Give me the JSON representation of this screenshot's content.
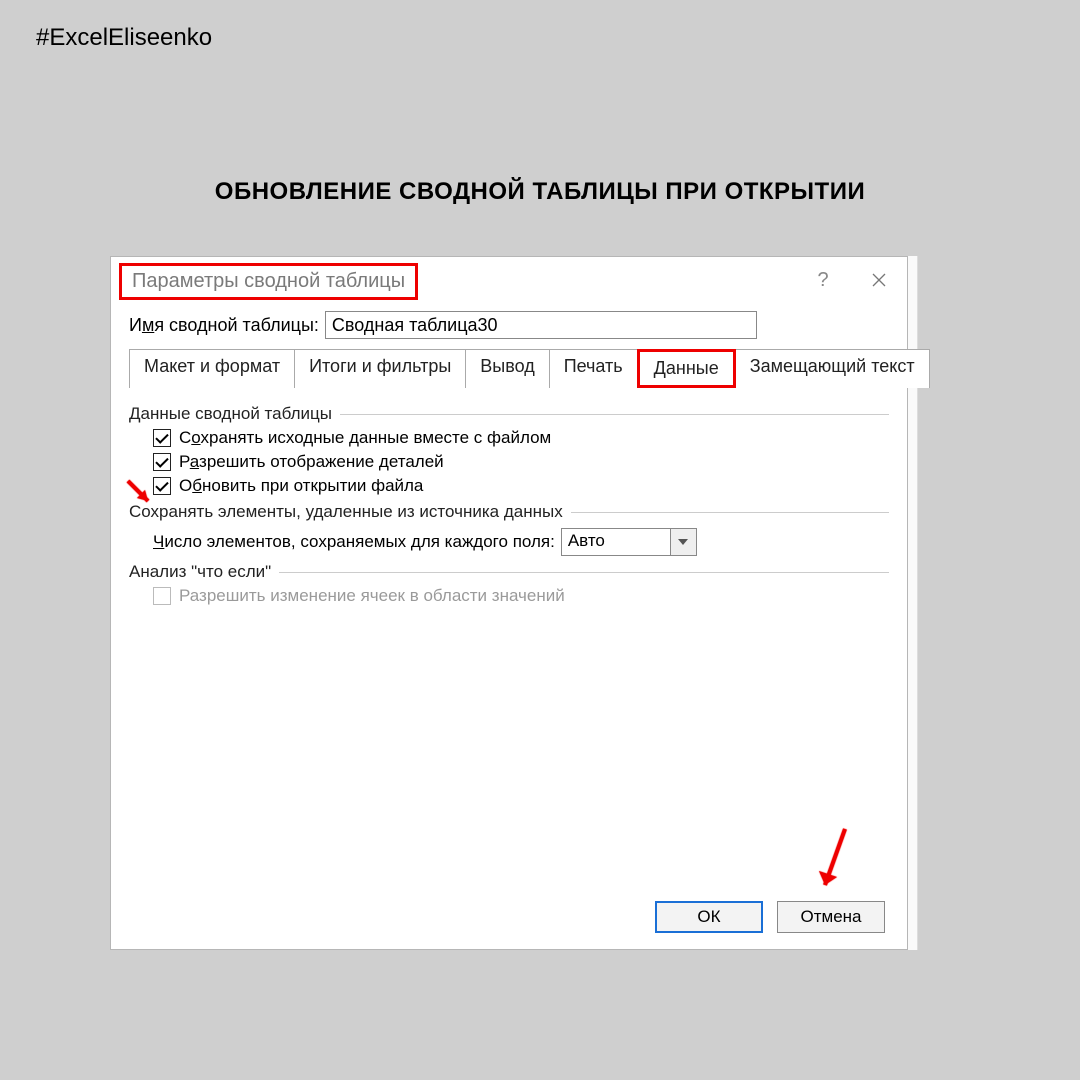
{
  "hashtag": "#ExcelEliseenko",
  "page_title": "ОБНОВЛЕНИЕ СВОДНОЙ ТАБЛИЦЫ ПРИ ОТКРЫТИИ",
  "dialog": {
    "title": "Параметры сводной таблицы",
    "help": "?",
    "name_label_pre": "И",
    "name_label_u": "м",
    "name_label_post": "я сводной таблицы:",
    "name_value": "Сводная таблица30",
    "tabs": {
      "t0": "Макет и формат",
      "t1": "Итоги и фильтры",
      "t2": "Вывод",
      "t3": "Печать",
      "t4": "Данные",
      "t5": "Замещающий текст"
    },
    "group1": "Данные сводной таблицы",
    "chk1_pre": "С",
    "chk1_u": "о",
    "chk1_post": "хранять исходные данные вместе с файлом",
    "chk2_pre": "Р",
    "chk2_u": "а",
    "chk2_post": "зрешить отображение деталей",
    "chk3_pre": "О",
    "chk3_u": "б",
    "chk3_post": "новить при открытии файла",
    "group2": "Сохранять элементы, удаленные из источника данных",
    "combo_label_pre": "Ч",
    "combo_label_u": "и",
    "combo_label_post": "сло элементов, сохраняемых для каждого поля:",
    "combo_value": "Авто",
    "group3": "Анализ \"что если\"",
    "chk4": "Разрешить изменение ячеек в области значений",
    "ok": "ОК",
    "cancel": "Отмена"
  }
}
